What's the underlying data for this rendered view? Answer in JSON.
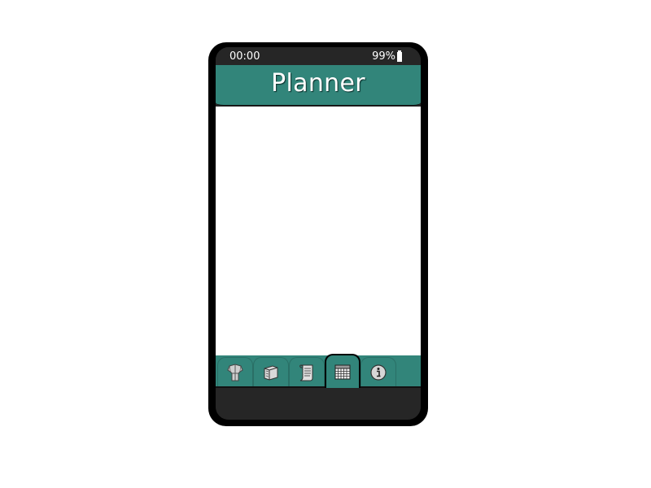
{
  "status_bar": {
    "time": "00:00",
    "battery": "99%"
  },
  "header": {
    "title": "Planner"
  },
  "tabs": [
    {
      "name": "tab-armor",
      "icon": "armor-icon"
    },
    {
      "name": "tab-book",
      "icon": "book-icon"
    },
    {
      "name": "tab-scroll",
      "icon": "scroll-icon"
    },
    {
      "name": "tab-calendar",
      "icon": "calendar-icon",
      "active": true
    },
    {
      "name": "tab-info",
      "icon": "info-icon"
    }
  ],
  "colors": {
    "accent": "#32857a",
    "frame": "#000000",
    "screen_dark": "#262626",
    "content_bg": "#ffffff"
  }
}
